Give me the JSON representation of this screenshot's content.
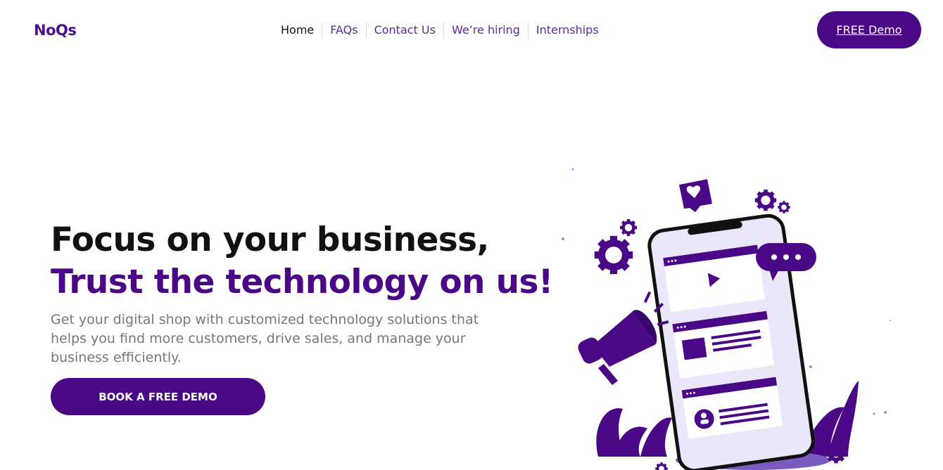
{
  "header": {
    "logo": "NoQs",
    "nav": [
      {
        "label": "Home",
        "active": true
      },
      {
        "label": "FAQs",
        "active": false
      },
      {
        "label": "Contact Us",
        "active": false
      },
      {
        "label": "We’re hiring",
        "active": false
      },
      {
        "label": "Internships",
        "active": false
      }
    ],
    "demo_button": "FREE Demo"
  },
  "hero": {
    "line1": "Focus on your business,",
    "line2": "Trust the technology on us!",
    "subtitle": "Get your digital shop with customized technology solutions that helps you find more customers, drive sales, and manage your business efficiently.",
    "cta": "BOOK A FREE DEMO"
  },
  "colors": {
    "brand": "#4b0886",
    "nav_link": "#5a2a9c",
    "text_muted": "#777777",
    "phone_screen": "#ece6fb"
  },
  "icons": [
    "megaphone-icon",
    "heart-message-icon",
    "chat-bubble-icon",
    "gear-icon",
    "play-icon",
    "user-icon"
  ]
}
